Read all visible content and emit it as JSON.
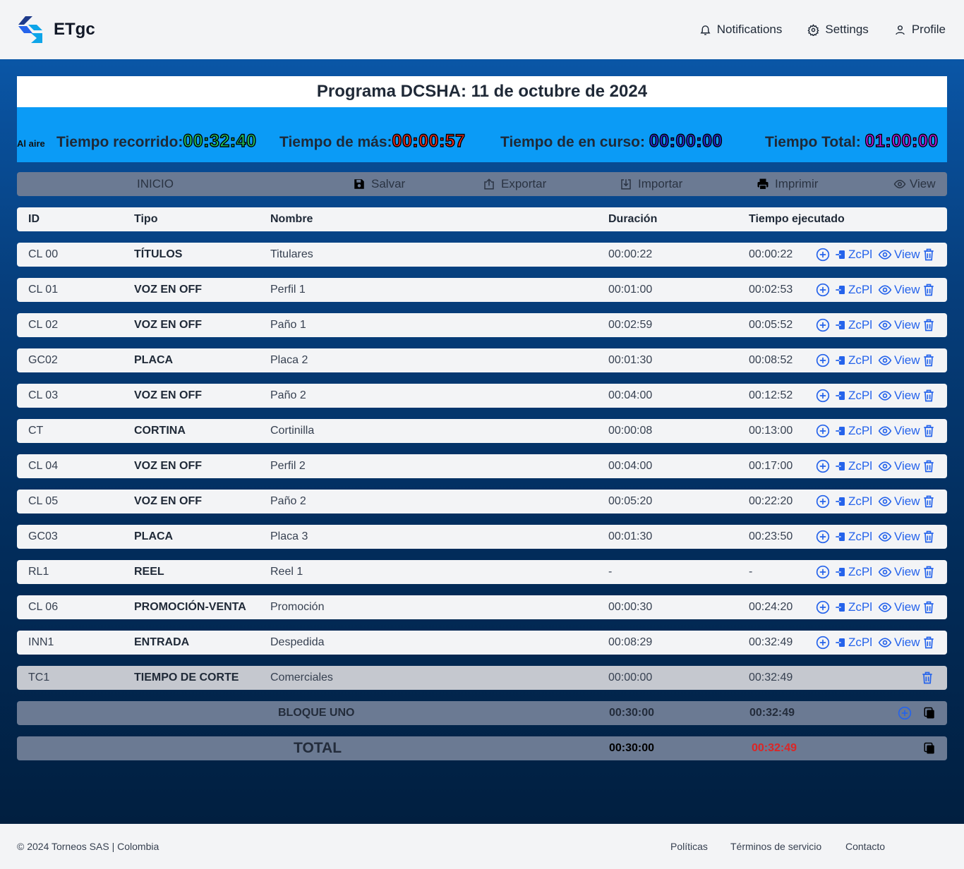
{
  "header": {
    "brand": "ETgc",
    "nav": {
      "notifications": "Notifications",
      "settings": "Settings",
      "profile": "Profile"
    }
  },
  "program": {
    "title": "Programa DCSHA: 11 de octubre de 2024",
    "al_aire": "Al aire",
    "timers": {
      "recorrido_label": "Tiempo recorrido:",
      "recorrido_value": "00:32:40",
      "recorrido_color": "#22c55e",
      "mas_label": "Tiempo de más:",
      "mas_value": "00:00:57",
      "mas_color": "#ef2b1d",
      "curso_label": "Tiempo de en curso:",
      "curso_value": "00:00:00",
      "curso_color": "#2b2bd8",
      "total_label": "Tiempo Total:",
      "total_value": "01:00:00",
      "total_color": "#b91ce0"
    }
  },
  "toolbar": {
    "inicio": "INICIO",
    "salvar": "Salvar",
    "exportar": "Exportar",
    "importar": "Importar",
    "imprimir": "Imprimir",
    "view": "View"
  },
  "table": {
    "headers": {
      "id": "ID",
      "tipo": "Tipo",
      "nombre": "Nombre",
      "duracion": "Duración",
      "ejecutado": "Tiempo ejecutado"
    },
    "action_labels": {
      "zcpl": "ZcPl",
      "view": "View"
    },
    "rows": [
      {
        "id": "CL 00",
        "tipo": "TÍTULOS",
        "nombre": "Titulares",
        "duracion": "00:00:22",
        "ejecutado": "00:00:22"
      },
      {
        "id": "CL 01",
        "tipo": "VOZ EN OFF",
        "nombre": "Perfil 1",
        "duracion": "00:01:00",
        "ejecutado": "00:02:53"
      },
      {
        "id": "CL 02",
        "tipo": "VOZ EN OFF",
        "nombre": "Paño 1",
        "duracion": "00:02:59",
        "ejecutado": "00:05:52"
      },
      {
        "id": "GC02",
        "tipo": "PLACA",
        "nombre": "Placa 2",
        "duracion": "00:01:30",
        "ejecutado": "00:08:52"
      },
      {
        "id": "CL 03",
        "tipo": "VOZ EN OFF",
        "nombre": "Paño 2",
        "duracion": "00:04:00",
        "ejecutado": "00:12:52"
      },
      {
        "id": "CT",
        "tipo": "CORTINA",
        "nombre": "Cortinilla",
        "duracion": "00:00:08",
        "ejecutado": "00:13:00"
      },
      {
        "id": "CL 04",
        "tipo": "VOZ EN OFF",
        "nombre": "Perfil 2",
        "duracion": "00:04:00",
        "ejecutado": "00:17:00"
      },
      {
        "id": "CL 05",
        "tipo": "VOZ EN OFF",
        "nombre": "Paño 2",
        "duracion": "00:05:20",
        "ejecutado": "00:22:20"
      },
      {
        "id": "GC03",
        "tipo": "PLACA",
        "nombre": "Placa 3",
        "duracion": "00:01:30",
        "ejecutado": "00:23:50"
      },
      {
        "id": "RL1",
        "tipo": "REEL",
        "nombre": "Reel 1",
        "duracion": "-",
        "ejecutado": "-"
      },
      {
        "id": "CL 06",
        "tipo": "PROMOCIÓN-VENTA",
        "nombre": "Promoción",
        "duracion": "00:00:30",
        "ejecutado": "00:24:20"
      },
      {
        "id": "INN1",
        "tipo": "ENTRADA",
        "nombre": "Despedida",
        "duracion": "00:08:29",
        "ejecutado": "00:32:49"
      }
    ],
    "cut_row": {
      "id": "TC1",
      "tipo": "TIEMPO DE CORTE",
      "nombre": "Comerciales",
      "duracion": "00:00:00",
      "ejecutado": "00:32:49"
    }
  },
  "block": {
    "label": "BLOQUE UNO",
    "duracion": "00:30:00",
    "ejecutado": "00:32:49"
  },
  "total": {
    "label": "TOTAL",
    "duracion": "00:30:00",
    "ejecutado": "00:32:49",
    "ejecutado_color": "#dc2626"
  },
  "footer": {
    "copyright": "© 2024 Torneos SAS | Colombia",
    "politicas": "Políticas",
    "terminos": "Términos de servicio",
    "contacto": "Contacto"
  }
}
